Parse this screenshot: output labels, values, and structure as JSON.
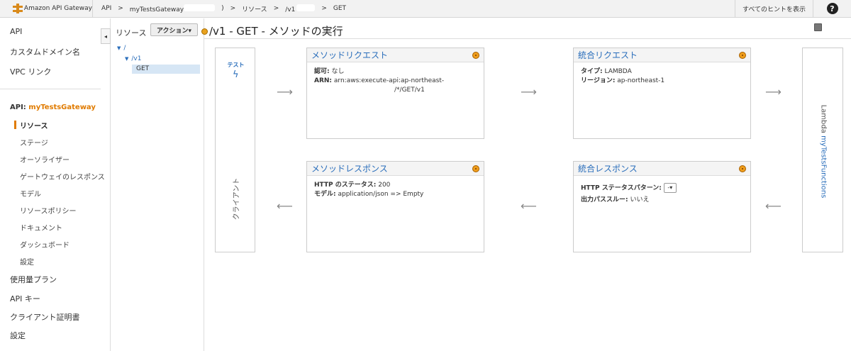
{
  "topbar": {
    "service_name": "Amazon API Gateway",
    "crumbs": [
      "API",
      ">",
      "myTestsGateway",
      ")",
      ">",
      "リソース",
      ">",
      "/v1",
      ">",
      "GET"
    ],
    "hints_label": "すべてのヒントを表示",
    "help_label": "?"
  },
  "leftnav": {
    "items_top": [
      "API",
      "カスタムドメイン名",
      "VPC リンク"
    ],
    "api_prefix": "API:",
    "api_name": "myTestsGateway",
    "sub_items": [
      "リソース",
      "ステージ",
      "オーソライザー",
      "ゲートウェイのレスポンス",
      "モデル",
      "リソースポリシー",
      "ドキュメント",
      "ダッシュボード",
      "設定"
    ],
    "items_bottom": [
      "使用量プラン",
      "API キー",
      "クライアント証明書",
      "設定"
    ],
    "collapse_glyph": "◂"
  },
  "tree": {
    "title": "リソース",
    "actions_label": "アクション▾",
    "root": "/",
    "v1": "/v1",
    "selected": "GET"
  },
  "main": {
    "title": "/v1 - GET - メソッドの実行",
    "client": {
      "test_label": "テスト",
      "bolt": "ϟ",
      "label": "クライアント"
    },
    "lambda": {
      "prefix": "Lambda",
      "function_name": "myTestsFunctions"
    },
    "method_request": {
      "title": "メソッドリクエスト",
      "auth_key": "認可:",
      "auth_value": "なし",
      "arn_key": "ARN:",
      "arn_line1": "arn:aws:execute-api:ap-northeast-",
      "arn_line2": "/*/GET/v1"
    },
    "integration_request": {
      "title": "統合リクエスト",
      "type_key": "タイプ:",
      "type_value": "LAMBDA",
      "region_key": "リージョン:",
      "region_value": "ap-northeast-1"
    },
    "method_response": {
      "title": "メソッドレスポンス",
      "status_key": "HTTP のステータス:",
      "status_value": "200",
      "model_key": "モデル:",
      "model_value": "application/json => Empty"
    },
    "integration_response": {
      "title": "統合レスポンス",
      "pattern_key": "HTTP ステータスパターン:",
      "pattern_value": "-",
      "passthrough_key": "出力パススルー:",
      "passthrough_value": "いいえ"
    },
    "arrow_right": "⟶",
    "arrow_left": "⟵"
  }
}
